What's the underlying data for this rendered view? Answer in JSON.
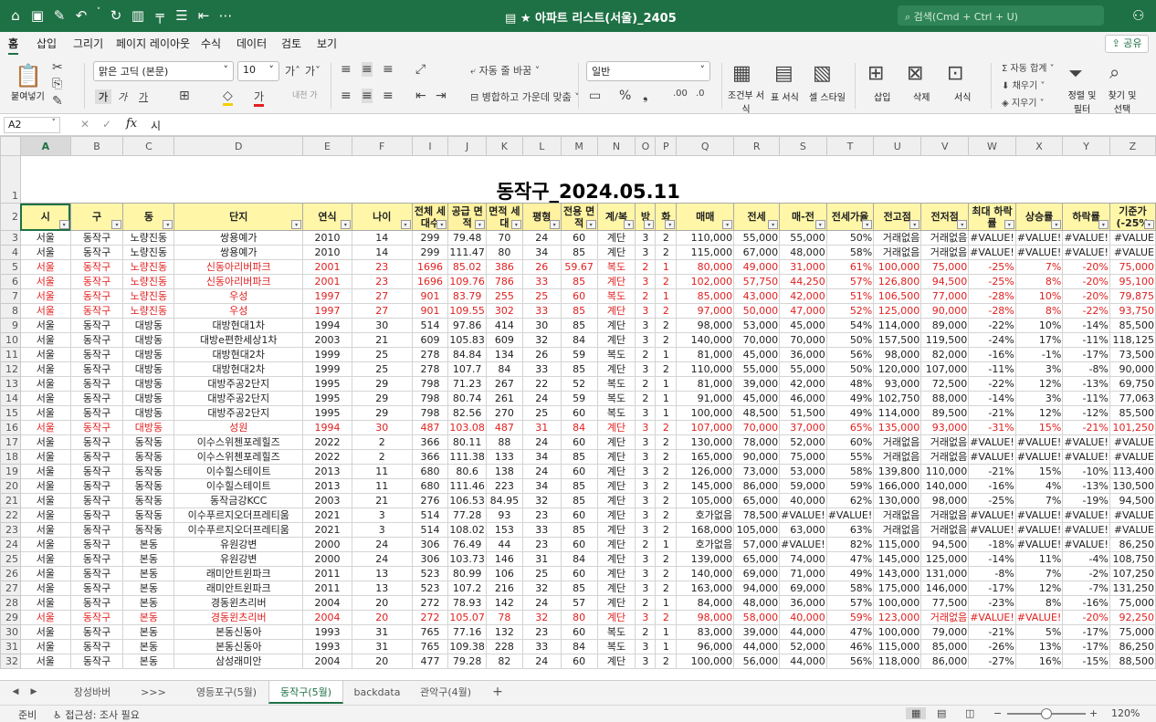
{
  "title_bar": {
    "icons": [
      "home-icon",
      "save-icon",
      "edit-icon",
      "undo-icon",
      "redo-icon",
      "chart-icon",
      "pivot-icon",
      "form-icon",
      "outline-icon",
      "more-icon"
    ],
    "document": "★ 아파트 리스트(서울)_2405",
    "search_placeholder": "검색(Cmd + Ctrl + U)"
  },
  "ribbon_tabs": [
    "홈",
    "삽입",
    "그리기",
    "페이지 레이아웃",
    "수식",
    "데이터",
    "검토",
    "보기"
  ],
  "share_label": "공유",
  "ribbon": {
    "paste": "붙여넣기",
    "font": "맑은 고딕 (본문)",
    "size": "10",
    "autowrap": "자동 줄 바꿈",
    "merge": "병합하고 가운데 맞춤",
    "format": "일반",
    "cond": "조건부 서식",
    "table": "표 서식",
    "style": "셀 스타일",
    "insert": "삽입",
    "delete": "삭제",
    "fmt": "서식",
    "autosum": "자동 합계",
    "fill": "채우기",
    "clear": "지우기",
    "sort": "정렬 및 필터",
    "find": "찾기 및 선택",
    "bold": "가",
    "italic": "가",
    "under": "가",
    "ext": "내천 가"
  },
  "formula_bar": {
    "name_box": "A2",
    "formula": "시"
  },
  "sheet": {
    "title": "동작구_2024.05.11",
    "columns": [
      "A",
      "B",
      "C",
      "D",
      "E",
      "F",
      "I",
      "J",
      "K",
      "L",
      "M",
      "N",
      "O",
      "P",
      "Q",
      "R",
      "S",
      "T",
      "U",
      "V",
      "W",
      "X",
      "Y",
      "Z"
    ],
    "headers": [
      "시",
      "구",
      "동",
      "단지",
      "연식",
      "나이",
      "전체 세대수",
      "공급 면적",
      "면적 세대",
      "평형",
      "전용 면적",
      "계/복",
      "방",
      "화",
      "매매",
      "전세",
      "매-전",
      "전세가율",
      "전고점",
      "전저점",
      "최대 하락률",
      "상승률",
      "하락률",
      "기준가 (-25%"
    ],
    "row_numbers": [
      "1",
      "2",
      "3",
      "4",
      "5",
      "6",
      "7",
      "8",
      "9",
      "10",
      "11",
      "12",
      "13",
      "14",
      "15",
      "16",
      "17",
      "18",
      "19",
      "20",
      "21",
      "22",
      "23",
      "24",
      "25",
      "26",
      "27",
      "28",
      "29",
      "30",
      "31",
      "32"
    ],
    "rows": [
      {
        "red": false,
        "c": [
          "서울",
          "동작구",
          "노량진동",
          "쌍용예가",
          "2010",
          "14",
          "299",
          "79.48",
          "70",
          "24",
          "60",
          "계단",
          "3",
          "2",
          "110,000",
          "55,000",
          "55,000",
          "50%",
          "거래없음",
          "거래없음",
          "#VALUE!",
          "#VALUE!",
          "#VALUE!",
          "#VALUE"
        ]
      },
      {
        "red": false,
        "c": [
          "서울",
          "동작구",
          "노량진동",
          "쌍용예가",
          "2010",
          "14",
          "299",
          "111.47",
          "80",
          "34",
          "85",
          "계단",
          "3",
          "2",
          "115,000",
          "67,000",
          "48,000",
          "58%",
          "거래없음",
          "거래없음",
          "#VALUE!",
          "#VALUE!",
          "#VALUE!",
          "#VALUE"
        ]
      },
      {
        "red": true,
        "c": [
          "서울",
          "동작구",
          "노량진동",
          "신동아리버파크",
          "2001",
          "23",
          "1696",
          "85.02",
          "386",
          "26",
          "59.67",
          "복도",
          "2",
          "1",
          "80,000",
          "49,000",
          "31,000",
          "61%",
          "100,000",
          "75,000",
          "-25%",
          "7%",
          "-20%",
          "75,000"
        ]
      },
      {
        "red": true,
        "c": [
          "서울",
          "동작구",
          "노량진동",
          "신동아리버파크",
          "2001",
          "23",
          "1696",
          "109.76",
          "786",
          "33",
          "85",
          "계단",
          "3",
          "2",
          "102,000",
          "57,750",
          "44,250",
          "57%",
          "126,800",
          "94,500",
          "-25%",
          "8%",
          "-20%",
          "95,100"
        ]
      },
      {
        "red": true,
        "c": [
          "서울",
          "동작구",
          "노량진동",
          "우성",
          "1997",
          "27",
          "901",
          "83.79",
          "255",
          "25",
          "60",
          "복도",
          "2",
          "1",
          "85,000",
          "43,000",
          "42,000",
          "51%",
          "106,500",
          "77,000",
          "-28%",
          "10%",
          "-20%",
          "79,875"
        ]
      },
      {
        "red": true,
        "c": [
          "서울",
          "동작구",
          "노량진동",
          "우성",
          "1997",
          "27",
          "901",
          "109.55",
          "302",
          "33",
          "85",
          "계단",
          "3",
          "2",
          "97,000",
          "50,000",
          "47,000",
          "52%",
          "125,000",
          "90,000",
          "-28%",
          "8%",
          "-22%",
          "93,750"
        ]
      },
      {
        "red": false,
        "c": [
          "서울",
          "동작구",
          "대방동",
          "대방현대1차",
          "1994",
          "30",
          "514",
          "97.86",
          "414",
          "30",
          "85",
          "계단",
          "3",
          "2",
          "98,000",
          "53,000",
          "45,000",
          "54%",
          "114,000",
          "89,000",
          "-22%",
          "10%",
          "-14%",
          "85,500"
        ]
      },
      {
        "red": false,
        "c": [
          "서울",
          "동작구",
          "대방동",
          "대방e편한세상1차",
          "2003",
          "21",
          "609",
          "105.83",
          "609",
          "32",
          "84",
          "계단",
          "3",
          "2",
          "140,000",
          "70,000",
          "70,000",
          "50%",
          "157,500",
          "119,500",
          "-24%",
          "17%",
          "-11%",
          "118,125"
        ]
      },
      {
        "red": false,
        "c": [
          "서울",
          "동작구",
          "대방동",
          "대방현대2차",
          "1999",
          "25",
          "278",
          "84.84",
          "134",
          "26",
          "59",
          "복도",
          "2",
          "1",
          "81,000",
          "45,000",
          "36,000",
          "56%",
          "98,000",
          "82,000",
          "-16%",
          "-1%",
          "-17%",
          "73,500"
        ]
      },
      {
        "red": false,
        "c": [
          "서울",
          "동작구",
          "대방동",
          "대방현대2차",
          "1999",
          "25",
          "278",
          "107.7",
          "84",
          "33",
          "85",
          "계단",
          "3",
          "2",
          "110,000",
          "55,000",
          "55,000",
          "50%",
          "120,000",
          "107,000",
          "-11%",
          "3%",
          "-8%",
          "90,000"
        ]
      },
      {
        "red": false,
        "c": [
          "서울",
          "동작구",
          "대방동",
          "대방주공2단지",
          "1995",
          "29",
          "798",
          "71.23",
          "267",
          "22",
          "52",
          "복도",
          "2",
          "1",
          "81,000",
          "39,000",
          "42,000",
          "48%",
          "93,000",
          "72,500",
          "-22%",
          "12%",
          "-13%",
          "69,750"
        ]
      },
      {
        "red": false,
        "c": [
          "서울",
          "동작구",
          "대방동",
          "대방주공2단지",
          "1995",
          "29",
          "798",
          "80.74",
          "261",
          "24",
          "59",
          "복도",
          "2",
          "1",
          "91,000",
          "45,000",
          "46,000",
          "49%",
          "102,750",
          "88,000",
          "-14%",
          "3%",
          "-11%",
          "77,063"
        ]
      },
      {
        "red": false,
        "c": [
          "서울",
          "동작구",
          "대방동",
          "대방주공2단지",
          "1995",
          "29",
          "798",
          "82.56",
          "270",
          "25",
          "60",
          "복도",
          "3",
          "1",
          "100,000",
          "48,500",
          "51,500",
          "49%",
          "114,000",
          "89,500",
          "-21%",
          "12%",
          "-12%",
          "85,500"
        ]
      },
      {
        "red": true,
        "c": [
          "서울",
          "동작구",
          "대방동",
          "성원",
          "1994",
          "30",
          "487",
          "103.08",
          "487",
          "31",
          "84",
          "계단",
          "3",
          "2",
          "107,000",
          "70,000",
          "37,000",
          "65%",
          "135,000",
          "93,000",
          "-31%",
          "15%",
          "-21%",
          "101,250"
        ]
      },
      {
        "red": false,
        "c": [
          "서울",
          "동작구",
          "동작동",
          "이수스위첸포레힐즈",
          "2022",
          "2",
          "366",
          "80.11",
          "88",
          "24",
          "60",
          "계단",
          "3",
          "2",
          "130,000",
          "78,000",
          "52,000",
          "60%",
          "거래없음",
          "거래없음",
          "#VALUE!",
          "#VALUE!",
          "#VALUE!",
          "#VALUE"
        ]
      },
      {
        "red": false,
        "c": [
          "서울",
          "동작구",
          "동작동",
          "이수스위첸포레힐즈",
          "2022",
          "2",
          "366",
          "111.38",
          "133",
          "34",
          "85",
          "계단",
          "3",
          "2",
          "165,000",
          "90,000",
          "75,000",
          "55%",
          "거래없음",
          "거래없음",
          "#VALUE!",
          "#VALUE!",
          "#VALUE!",
          "#VALUE"
        ]
      },
      {
        "red": false,
        "c": [
          "서울",
          "동작구",
          "동작동",
          "이수힐스테이트",
          "2013",
          "11",
          "680",
          "80.6",
          "138",
          "24",
          "60",
          "계단",
          "3",
          "2",
          "126,000",
          "73,000",
          "53,000",
          "58%",
          "139,800",
          "110,000",
          "-21%",
          "15%",
          "-10%",
          "113,400"
        ]
      },
      {
        "red": false,
        "c": [
          "서울",
          "동작구",
          "동작동",
          "이수힐스테이트",
          "2013",
          "11",
          "680",
          "111.46",
          "223",
          "34",
          "85",
          "계단",
          "3",
          "2",
          "145,000",
          "86,000",
          "59,000",
          "59%",
          "166,000",
          "140,000",
          "-16%",
          "4%",
          "-13%",
          "130,500"
        ]
      },
      {
        "red": false,
        "c": [
          "서울",
          "동작구",
          "동작동",
          "동작금강KCC",
          "2003",
          "21",
          "276",
          "106.53",
          "84.95",
          "32",
          "85",
          "계단",
          "3",
          "2",
          "105,000",
          "65,000",
          "40,000",
          "62%",
          "130,000",
          "98,000",
          "-25%",
          "7%",
          "-19%",
          "94,500"
        ]
      },
      {
        "red": false,
        "c": [
          "서울",
          "동작구",
          "동작동",
          "이수푸르지오더프레티움",
          "2021",
          "3",
          "514",
          "77.28",
          "93",
          "23",
          "60",
          "계단",
          "3",
          "2",
          "호가없음",
          "78,500",
          "#VALUE!",
          "#VALUE!",
          "거래없음",
          "거래없음",
          "#VALUE!",
          "#VALUE!",
          "#VALUE!",
          "#VALUE"
        ]
      },
      {
        "red": false,
        "c": [
          "서울",
          "동작구",
          "동작동",
          "이수푸르지오더프레티움",
          "2021",
          "3",
          "514",
          "108.02",
          "153",
          "33",
          "85",
          "계단",
          "3",
          "2",
          "168,000",
          "105,000",
          "63,000",
          "63%",
          "거래없음",
          "거래없음",
          "#VALUE!",
          "#VALUE!",
          "#VALUE!",
          "#VALUE"
        ]
      },
      {
        "red": false,
        "c": [
          "서울",
          "동작구",
          "본동",
          "유원강변",
          "2000",
          "24",
          "306",
          "76.49",
          "44",
          "23",
          "60",
          "계단",
          "2",
          "1",
          "호가없음",
          "57,000",
          "#VALUE!",
          "82%",
          "115,000",
          "94,500",
          "-18%",
          "#VALUE!",
          "#VALUE!",
          "86,250"
        ]
      },
      {
        "red": false,
        "c": [
          "서울",
          "동작구",
          "본동",
          "유원강변",
          "2000",
          "24",
          "306",
          "103.73",
          "146",
          "31",
          "84",
          "계단",
          "3",
          "2",
          "139,000",
          "65,000",
          "74,000",
          "47%",
          "145,000",
          "125,000",
          "-14%",
          "11%",
          "-4%",
          "108,750"
        ]
      },
      {
        "red": false,
        "c": [
          "서울",
          "동작구",
          "본동",
          "래미안트윈파크",
          "2011",
          "13",
          "523",
          "80.99",
          "106",
          "25",
          "60",
          "계단",
          "3",
          "2",
          "140,000",
          "69,000",
          "71,000",
          "49%",
          "143,000",
          "131,000",
          "-8%",
          "7%",
          "-2%",
          "107,250"
        ]
      },
      {
        "red": false,
        "c": [
          "서울",
          "동작구",
          "본동",
          "래미안트윈파크",
          "2011",
          "13",
          "523",
          "107.2",
          "216",
          "32",
          "85",
          "계단",
          "3",
          "2",
          "163,000",
          "94,000",
          "69,000",
          "58%",
          "175,000",
          "146,000",
          "-17%",
          "12%",
          "-7%",
          "131,250"
        ]
      },
      {
        "red": false,
        "c": [
          "서울",
          "동작구",
          "본동",
          "경동윈츠리버",
          "2004",
          "20",
          "272",
          "78.93",
          "142",
          "24",
          "57",
          "계단",
          "2",
          "1",
          "84,000",
          "48,000",
          "36,000",
          "57%",
          "100,000",
          "77,500",
          "-23%",
          "8%",
          "-16%",
          "75,000"
        ]
      },
      {
        "red": true,
        "c": [
          "서울",
          "동작구",
          "본동",
          "경동윈츠리버",
          "2004",
          "20",
          "272",
          "105.07",
          "78",
          "32",
          "80",
          "계단",
          "3",
          "2",
          "98,000",
          "58,000",
          "40,000",
          "59%",
          "123,000",
          "거래없음",
          "#VALUE!",
          "#VALUE!",
          "-20%",
          "92,250"
        ]
      },
      {
        "red": false,
        "c": [
          "서울",
          "동작구",
          "본동",
          "본동신동아",
          "1993",
          "31",
          "765",
          "77.16",
          "132",
          "23",
          "60",
          "복도",
          "2",
          "1",
          "83,000",
          "39,000",
          "44,000",
          "47%",
          "100,000",
          "79,000",
          "-21%",
          "5%",
          "-17%",
          "75,000"
        ]
      },
      {
        "red": false,
        "c": [
          "서울",
          "동작구",
          "본동",
          "본동신동아",
          "1993",
          "31",
          "765",
          "109.38",
          "228",
          "33",
          "84",
          "복도",
          "3",
          "1",
          "96,000",
          "44,000",
          "52,000",
          "46%",
          "115,000",
          "85,000",
          "-26%",
          "13%",
          "-17%",
          "86,250"
        ]
      },
      {
        "red": false,
        "c": [
          "서울",
          "동작구",
          "본동",
          "삼성래미안",
          "2004",
          "20",
          "477",
          "79.28",
          "82",
          "24",
          "60",
          "계단",
          "3",
          "2",
          "100,000",
          "56,000",
          "44,000",
          "56%",
          "118,000",
          "86,000",
          "-27%",
          "16%",
          "-15%",
          "88,500"
        ]
      }
    ]
  },
  "sheet_tabs": [
    "장성바버",
    "&gt;&gt;&gt;",
    "영등포구(5월)",
    "동작구(5월)",
    "backdata",
    "관악구(4월)",
    "+"
  ],
  "status": {
    "ready": "준비",
    "access": "접근성: 조사 필요",
    "zoom": "120%"
  }
}
